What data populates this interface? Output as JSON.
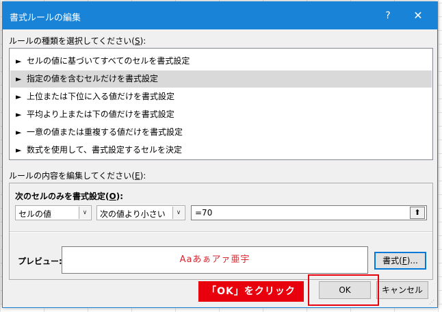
{
  "dialog": {
    "title": "書式ルールの編集",
    "help_glyph": "?",
    "close_glyph": "✕"
  },
  "rule_type": {
    "label_prefix": "ルールの種類を選択してください(",
    "label_key": "S",
    "label_suffix": "):",
    "arrow_glyph": "►",
    "items": [
      {
        "label": "セルの値に基づいてすべてのセルを書式設定",
        "selected": false
      },
      {
        "label": "指定の値を含むセルだけを書式設定",
        "selected": true
      },
      {
        "label": "上位または下位に入る値だけを書式設定",
        "selected": false
      },
      {
        "label": "平均より上または下の値だけを書式設定",
        "selected": false
      },
      {
        "label": "一意の値または重複する値だけを書式設定",
        "selected": false
      },
      {
        "label": "数式を使用して、書式設定するセルを決定",
        "selected": false
      }
    ]
  },
  "rule_edit": {
    "label_prefix": "ルールの内容を編集してください(",
    "label_key": "E",
    "label_suffix": "):",
    "section_prefix": "次のセルのみを書式設定(",
    "section_key": "O",
    "section_suffix": "):",
    "condition_type": "セルの値",
    "operator": "次の値より小さい",
    "value": "=70",
    "collapse_glyph": "⬆",
    "dropdown_glyph": "∨"
  },
  "preview": {
    "label": "プレビュー:",
    "sample_text": "Aaあぁアァ亜宇",
    "sample_color": "#d9232e",
    "format_button_prefix": "書式(",
    "format_button_key": "F",
    "format_button_suffix": ")..."
  },
  "buttons": {
    "ok": "OK",
    "cancel": "キャンセル"
  },
  "annotation": {
    "callout_text": "「OK」をクリック",
    "color": "#e8000d"
  },
  "colors": {
    "titlebar": "#1883d7",
    "dialog_bg": "#f0f0f0",
    "selected_row": "#d9d9d9"
  }
}
